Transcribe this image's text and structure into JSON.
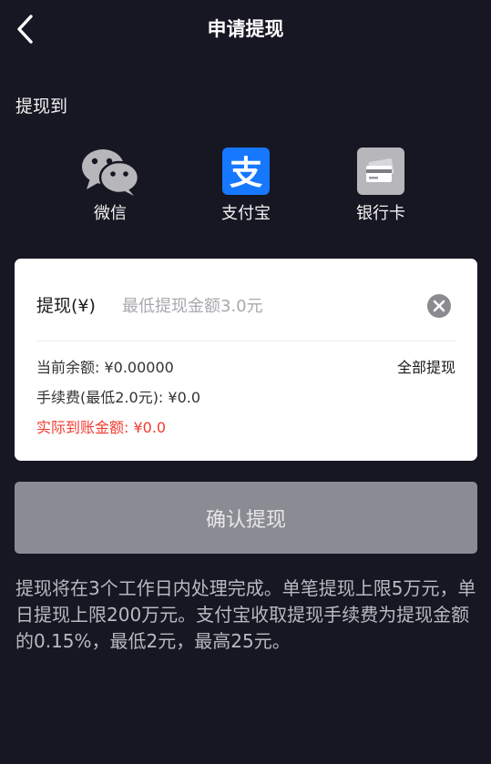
{
  "header": {
    "title": "申请提现"
  },
  "section": {
    "label": "提现到"
  },
  "methods": [
    {
      "label": "微信",
      "icon": "wechat-icon"
    },
    {
      "label": "支付宝",
      "icon": "alipay-icon"
    },
    {
      "label": "银行卡",
      "icon": "bank-card-icon"
    }
  ],
  "card": {
    "amount_label": "提现(¥)",
    "amount_value": "",
    "amount_placeholder": "最低提现金额3.0元",
    "balance": "当前余额: ¥0.00000",
    "withdraw_all": "全部提现",
    "fee": "手续费(最低2.0元): ¥0.0",
    "actual": "实际到账金额: ¥0.0"
  },
  "confirm": {
    "label": "确认提现"
  },
  "notice": "提现将在3个工作日内处理完成。单笔提现上限5万元，单日提现上限200万元。支付宝收取提现手续费为提现金额的0.15%，最低2元，最高25元。",
  "colors": {
    "background": "#161722",
    "card": "#ffffff",
    "button_disabled": "#8b8c93",
    "alert_red": "#f23a2f",
    "alipay_blue": "#1678ff",
    "icon_gray": "#b7b7bb"
  }
}
